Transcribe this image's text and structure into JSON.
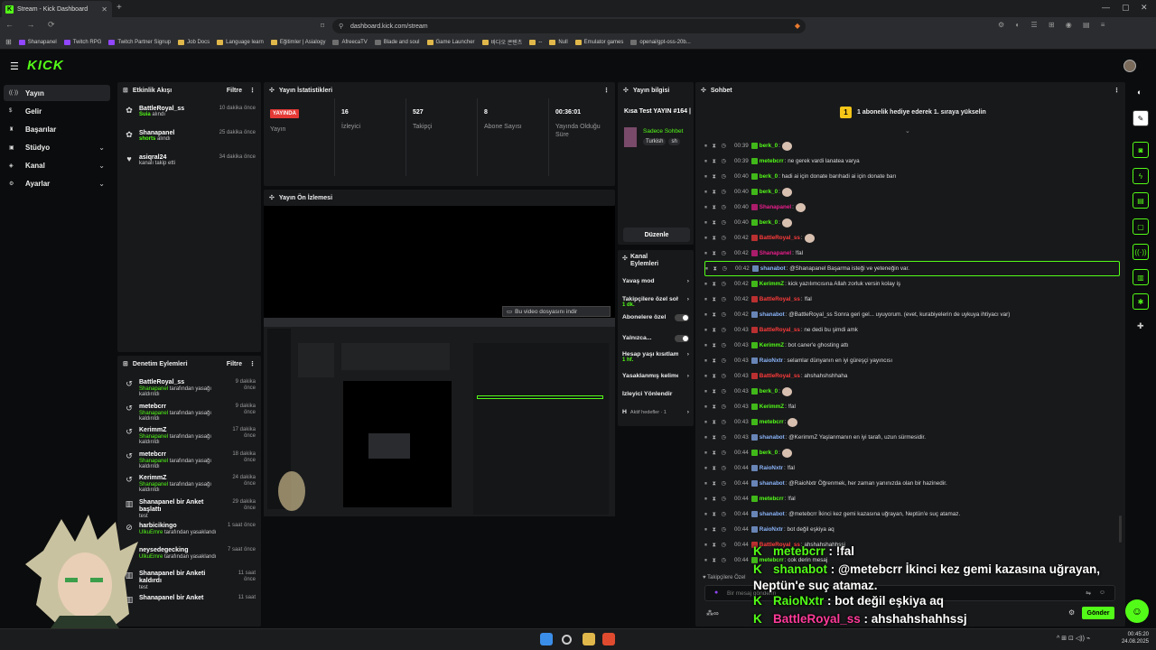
{
  "browser": {
    "tab_title": "Stream - Kick Dashboard",
    "tab_favicon": "K",
    "new_tab": "+",
    "url": "dashboard.kick.com/stream",
    "bookmarks": [
      "Shanapanel",
      "Twitch RPG",
      "Twitch Partner Signup",
      "Job Docs",
      "Language learn",
      "Eğitimler | Asialogy",
      "AfreecaTV",
      "Blade and soul",
      "Game Launcher",
      "바다오 콘텐츠",
      "--",
      "Null",
      "Emulator games",
      "openai/gpt-oss-20b..."
    ]
  },
  "app": {
    "logo": "KICK",
    "accent": "#53fc18",
    "sidebar": [
      {
        "label": "Yayın",
        "icon": "broadcast-icon",
        "active": true,
        "chevron": false
      },
      {
        "label": "Gelir",
        "icon": "revenue-icon",
        "active": false,
        "chevron": false
      },
      {
        "label": "Başarılar",
        "icon": "trophy-icon",
        "active": false,
        "chevron": false
      },
      {
        "label": "Stüdyo",
        "icon": "studio-icon",
        "active": false,
        "chevron": true
      },
      {
        "label": "Kanal",
        "icon": "channel-icon",
        "active": false,
        "chevron": true
      },
      {
        "label": "Ayarlar",
        "icon": "settings-icon",
        "active": false,
        "chevron": true
      }
    ]
  },
  "activity": {
    "title": "Etkinlik Akışı",
    "filter": "Filtre",
    "items": [
      {
        "name": "BattleRoyal_ss",
        "sub": "Suia",
        "sub_rest": " alındı",
        "time": "10 dakika önce",
        "icon": "gift-icon"
      },
      {
        "name": "Shanapanel",
        "sub": "shorts",
        "sub_rest": " alındı",
        "time": "25 dakika önce",
        "icon": "gift-icon"
      },
      {
        "name": "asiqral24",
        "sub": "",
        "sub_rest": "kanalı takip etti",
        "time": "34 dakika önce",
        "icon": "heart-icon"
      }
    ]
  },
  "stats": {
    "title": "Yayın İstatistikleri",
    "items": [
      {
        "value": "YAYINDA",
        "label": "Yayın",
        "is_badge": true
      },
      {
        "value": "16",
        "label": "İzleyici"
      },
      {
        "value": "527",
        "label": "Takipçi"
      },
      {
        "value": "8",
        "label": "Abone Sayısı"
      },
      {
        "value": "00:36:01",
        "label": "Yayında Olduğu Süre"
      }
    ]
  },
  "info": {
    "title": "Yayın bilgisi",
    "stream_title": "Kısa Test YAYIN #164 |",
    "category": "Sadece Sohbet",
    "tags": [
      "Turkish",
      "sh"
    ],
    "edit": "Düzenle"
  },
  "preview": {
    "title": "Yayın Ön İzlemesi",
    "download": "Bu video dosyasını indir"
  },
  "channel_actions": {
    "title": "Kanal Eylemleri",
    "items": [
      {
        "label": "Yavaş mod",
        "type": "chevron",
        "sub": ""
      },
      {
        "label": "Takipçilere özel sohbet",
        "type": "chevron",
        "sub": "1 dk."
      },
      {
        "label": "Abonelere özel",
        "type": "toggle",
        "sub": ""
      },
      {
        "label": "Yalnızca...",
        "type": "toggle",
        "sub": ""
      },
      {
        "label": "Hesap yaşı kısıtlaması",
        "type": "chevron",
        "sub": "1 hf."
      },
      {
        "label": "Yasaklanmış kelimeler",
        "type": "chevron",
        "sub": ""
      },
      {
        "label": "İzleyici Yönlendir",
        "type": "none",
        "sub": ""
      },
      {
        "label": "H",
        "type": "chevron",
        "sub": "Aktif hedefler · 1"
      }
    ]
  },
  "moderation": {
    "title": "Denetim Eylemleri",
    "filter": "Filtre",
    "items": [
      {
        "name": "BattleRoyal_ss",
        "by": "Shanapanel",
        "rest": " tarafından yasağı kaldırıldı",
        "time": "9 dakika önce",
        "icon": "unban-icon"
      },
      {
        "name": "metebcrr",
        "by": "Shanapanel",
        "rest": " tarafından yasağı kaldırıldı",
        "time": "9 dakika önce",
        "icon": "unban-icon"
      },
      {
        "name": "KerimmZ",
        "by": "Shanapanel",
        "rest": " tarafından yasağı kaldırıldı",
        "time": "17 dakika önce",
        "icon": "unban-icon"
      },
      {
        "name": "metebcrr",
        "by": "Shanapanel",
        "rest": " tarafından yasağı kaldırıldı",
        "time": "18 dakika önce",
        "icon": "unban-icon"
      },
      {
        "name": "KerimmZ",
        "by": "Shanapanel",
        "rest": " tarafından yasağı kaldırıldı",
        "time": "24 dakika önce",
        "icon": "unban-icon"
      },
      {
        "name": "Shanapanel bir Anket başlattı",
        "by": "",
        "rest": "test",
        "time": "29 dakika önce",
        "icon": "poll-icon"
      },
      {
        "name": "harbicikingo",
        "by": "UlkuEmre",
        "rest": " tarafından yasaklandı",
        "time": "1 saat önce",
        "icon": "ban-icon"
      },
      {
        "name": "neysedegecking",
        "by": "UlkuEmre",
        "rest": " tarafından yasaklandı",
        "time": "7 saat önce",
        "icon": "ban-icon"
      },
      {
        "name": "Shanapanel bir Anketi kaldırdı",
        "by": "",
        "rest": "test",
        "time": "11 saat önce",
        "icon": "poll-icon"
      },
      {
        "name": "Shanapanel bir Anket",
        "by": "",
        "rest": "",
        "time": "11 saat",
        "icon": "poll-icon"
      }
    ]
  },
  "chat": {
    "title": "Sohbet",
    "banner": "1 abonelik hediye ederek 1. sıraya yükselin",
    "messages": [
      {
        "time": "00:39",
        "user": "berk_0",
        "color": "#53fc18",
        "text": ":",
        "emote": true
      },
      {
        "time": "00:39",
        "user": "metebcrr",
        "color": "#53fc18",
        "text": ": ne gerek vardi lanatea varya",
        "emote": false
      },
      {
        "time": "00:40",
        "user": "berk_0",
        "color": "#53fc18",
        "text": ": hadi ai için donate barıhadi ai için donate barı",
        "emote": false
      },
      {
        "time": "00:40",
        "user": "berk_0",
        "color": "#53fc18",
        "text": ":",
        "emote": true
      },
      {
        "time": "00:40",
        "user": "Shanapanel",
        "color": "#e91e8c",
        "text": ":",
        "emote": true
      },
      {
        "time": "00:40",
        "user": "berk_0",
        "color": "#53fc18",
        "text": ":",
        "emote": true
      },
      {
        "time": "00:42",
        "user": "BattleRoyal_ss",
        "color": "#ff3b3b",
        "text": ":",
        "emote": true
      },
      {
        "time": "00:42",
        "user": "Shanapanel",
        "color": "#e91e8c",
        "text": ": !fal",
        "emote": false
      },
      {
        "time": "00:42",
        "user": "shanabot",
        "color": "#8ab4f8",
        "text": ": @Shanapanel Başarma isteği ve yeteneğin var.",
        "emote": false,
        "hl": true
      },
      {
        "time": "00:42",
        "user": "KerimmZ",
        "color": "#53fc18",
        "text": ": kick yazılımcısına Allah zorluk versin kolay iş",
        "emote": false
      },
      {
        "time": "00:42",
        "user": "BattleRoyal_ss",
        "color": "#ff3b3b",
        "text": ": !fal",
        "emote": false
      },
      {
        "time": "00:42",
        "user": "shanabot",
        "color": "#8ab4f8",
        "text": ": @BattleRoyal_ss Sonra geri gel... uyuyorum. (evet, kurabiyelerin de uykuya ihtiyacı var)",
        "emote": false
      },
      {
        "time": "00:43",
        "user": "BattleRoyal_ss",
        "color": "#ff3b3b",
        "text": ": ne dedi bu şimdi amk",
        "emote": false
      },
      {
        "time": "00:43",
        "user": "KerimmZ",
        "color": "#53fc18",
        "text": ": bot caner'e ghosting attı",
        "emote": false
      },
      {
        "time": "00:43",
        "user": "RaioNxtr",
        "color": "#8ab4f8",
        "text": ": selamlar dünyanın en iyi güreşçi yayıncısı",
        "emote": false
      },
      {
        "time": "00:43",
        "user": "BattleRoyal_ss",
        "color": "#ff3b3b",
        "text": ": ahshahshshhaha",
        "emote": false
      },
      {
        "time": "00:43",
        "user": "berk_0",
        "color": "#53fc18",
        "text": ":",
        "emote": true
      },
      {
        "time": "00:43",
        "user": "KerimmZ",
        "color": "#53fc18",
        "text": ": !fal",
        "emote": false
      },
      {
        "time": "00:43",
        "user": "metebcrr",
        "color": "#53fc18",
        "text": ":",
        "emote": true
      },
      {
        "time": "00:43",
        "user": "shanabot",
        "color": "#8ab4f8",
        "text": ": @KerimmZ Yaşlanmanın en iyi tarafı, uzun sürmesidir.",
        "emote": false
      },
      {
        "time": "00:44",
        "user": "berk_0",
        "color": "#53fc18",
        "text": ":",
        "emote": true
      },
      {
        "time": "00:44",
        "user": "RaioNxtr",
        "color": "#8ab4f8",
        "text": ": !fal",
        "emote": false
      },
      {
        "time": "00:44",
        "user": "shanabot",
        "color": "#8ab4f8",
        "text": ": @RaioNxtr Öğrenmek, her zaman yanınızda olan bir hazinedir.",
        "emote": false
      },
      {
        "time": "00:44",
        "user": "metebcrr",
        "color": "#53fc18",
        "text": ": !fal",
        "emote": false
      },
      {
        "time": "00:44",
        "user": "shanabot",
        "color": "#8ab4f8",
        "text": ": @metebcrr İkinci kez gemi kazasına uğrayan, Neptün'e suç atamaz.",
        "emote": false
      },
      {
        "time": "00:44",
        "user": "RaioNxtr",
        "color": "#8ab4f8",
        "text": ": bot değil eşkiya aq",
        "emote": false
      },
      {
        "time": "00:44",
        "user": "BattleRoyal_ss",
        "color": "#ff3b3b",
        "text": ": ahshahshahhssj",
        "emote": false
      },
      {
        "time": "00:44",
        "user": "metebcrr",
        "color": "#53fc18",
        "text": ": cok derin mesaj",
        "emote": false
      }
    ],
    "followers_only": "Takipçilere Özel",
    "input_placeholder": "Bir mesaj gönderin",
    "send": "Gönder"
  },
  "overlay": {
    "lines": [
      {
        "user": "metebcrr",
        "color": "#53fc18",
        "text": " : !fal"
      },
      {
        "user": "shanabot",
        "color": "#53fc18",
        "text": " : @metebcrr İkinci kez gemi kazasına uğrayan,"
      },
      {
        "user": "",
        "color": "#53fc18",
        "text": "Neptün'e suç atamaz."
      },
      {
        "user": "RaioNxtr",
        "color": "#53fc18",
        "text": " : bot değil eşkiya aq"
      },
      {
        "user": "BattleRoyal_ss",
        "color": "#ff3b9a",
        "text": " : ahshahshahhssj"
      },
      {
        "user": "metebcrr",
        "color": "#53fc18",
        "text": " : cok derin mesaj"
      }
    ]
  },
  "taskbar": {
    "time": "00:45:20",
    "date": "24.08.2025"
  }
}
